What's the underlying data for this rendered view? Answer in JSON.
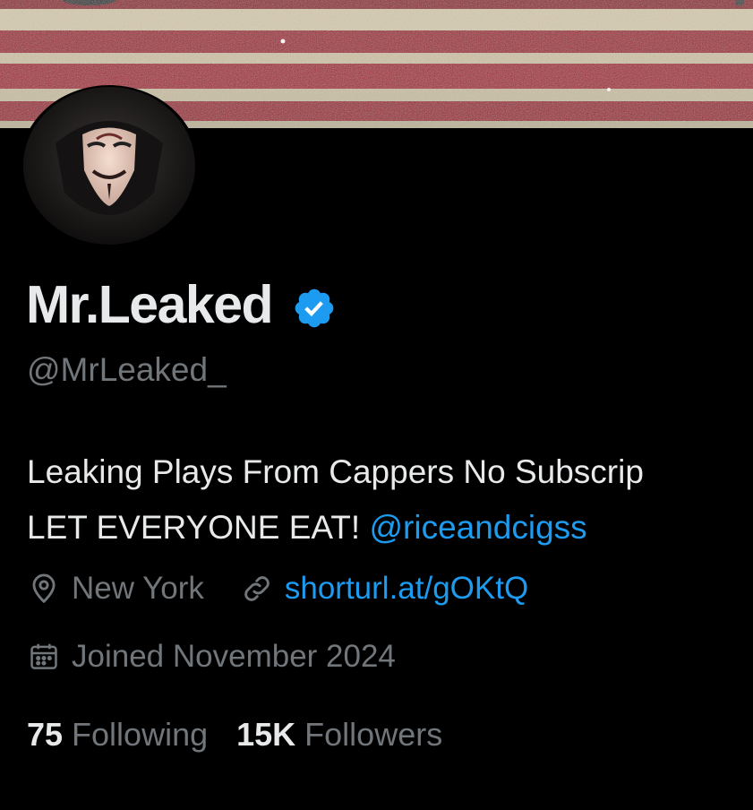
{
  "profile": {
    "display_name": "Mr.Leaked",
    "verified": true,
    "handle": "@MrLeaked_",
    "bio_line1": "Leaking Plays From Cappers No Subscrip",
    "bio_line2_text": "LET EVERYONE EAT!",
    "bio_mention": "@riceandcigss",
    "location": "New York",
    "website": "shorturl.at/gOKtQ",
    "joined": "Joined November 2024",
    "following_count": "75",
    "following_label": "Following",
    "followers_count": "15K",
    "followers_label": "Followers"
  },
  "icons": {
    "location": "location-pin-icon",
    "link": "link-icon",
    "calendar": "calendar-icon",
    "verified": "verified-badge-icon"
  },
  "colors": {
    "background": "#000000",
    "primary_text": "#e7e9ea",
    "secondary_text": "#71767b",
    "accent": "#1d9bf0",
    "banner_red": "#9e1a2e",
    "banner_white": "#d8cdb4"
  }
}
